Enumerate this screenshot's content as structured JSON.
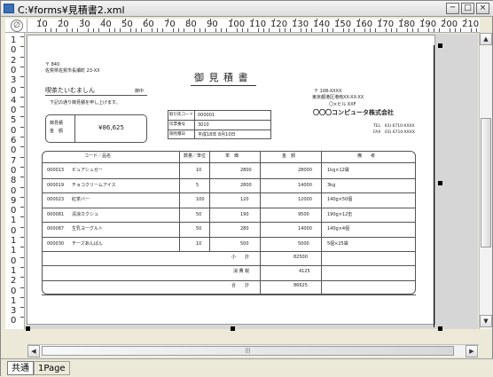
{
  "window": {
    "title": "C:¥forms¥見積書2.xml",
    "minimize_glyph": "─",
    "maximize_glyph": "□",
    "close_glyph": "×"
  },
  "ruler": {
    "corner_glyph": "∅",
    "h_labels": [
      "10",
      "20",
      "30",
      "40",
      "50",
      "60",
      "70",
      "80",
      "90",
      "100",
      "110",
      "120",
      "130",
      "140",
      "150",
      "160",
      "170",
      "180",
      "190",
      "200",
      "210"
    ],
    "v_labels": [
      "1",
      "0",
      "2",
      "0",
      "3",
      "0",
      "4",
      "0",
      "5",
      "0",
      "6",
      "0",
      "7",
      "0",
      "8",
      "0",
      "9",
      "0",
      "1",
      "0",
      "1",
      "1",
      "0",
      "1",
      "2",
      "0",
      "1",
      "3",
      "0"
    ]
  },
  "tabs": [
    {
      "label": "共通"
    },
    {
      "label": "1Page"
    }
  ],
  "scroll": {
    "up": "▲",
    "down": "▼",
    "left": "◀",
    "right": "▶",
    "grip": "|||"
  },
  "doc": {
    "postal": "〒 840",
    "address": "佐賀県佐賀市長瀬町 23-XX",
    "title": "御 見 積 書",
    "customer": "喫茶たいむましん",
    "customer_suffix": "御中",
    "intro": "下記の通り御見積を申し上げます。",
    "amount_label1": "御見積",
    "amount_label2": "金　額",
    "amount": "¥86,625",
    "info_rows": [
      {
        "label": "取引先コード",
        "value": "000001"
      },
      {
        "label": "伝票番号",
        "value": "3010"
      },
      {
        "label": "御見積日",
        "value": "平成18年 8月10日"
      }
    ],
    "company_postal": "〒 108-XXXX",
    "company_address": "東京都港区港南XX-XX-XX",
    "company_building": "〇×ビル XXF",
    "company_name": "〇〇〇コンピュータ株式会社",
    "tel": "TEL　03) 6710-XXXX",
    "fax": "FAX　03) 6710-XXXX",
    "headers": [
      "コード／品名",
      "数量／単位",
      "単　価",
      "金　額",
      "備　　考"
    ],
    "items": [
      {
        "code": "000013",
        "name": "ビュアシュガー",
        "qty": "10",
        "price": "2800",
        "amount": "28000",
        "note": "1kg×12袋"
      },
      {
        "code": "000019",
        "name": "チョコクリームアイス",
        "qty": "5",
        "price": "2800",
        "amount": "14000",
        "note": "3kg"
      },
      {
        "code": "000023",
        "name": "紅茶バー",
        "qty": "100",
        "price": "120",
        "amount": "12000",
        "note": "140g×50個"
      },
      {
        "code": "000081",
        "name": "清涼カクシュ",
        "qty": "50",
        "price": "190",
        "amount": "9500",
        "note": "190g×12缶"
      },
      {
        "code": "000087",
        "name": "生乳ヨーグルト",
        "qty": "50",
        "price": "280",
        "amount": "14000",
        "note": "140g×4個"
      },
      {
        "code": "000030",
        "name": "チーズあんぱん",
        "qty": "10",
        "price": "500",
        "amount": "5000",
        "note": "5個×25袋"
      }
    ],
    "subtotal_label": "小　　計",
    "subtotal": "82500",
    "tax_label": "消 費 税",
    "tax": "4125",
    "total_label": "合　　計",
    "total": "86625"
  }
}
